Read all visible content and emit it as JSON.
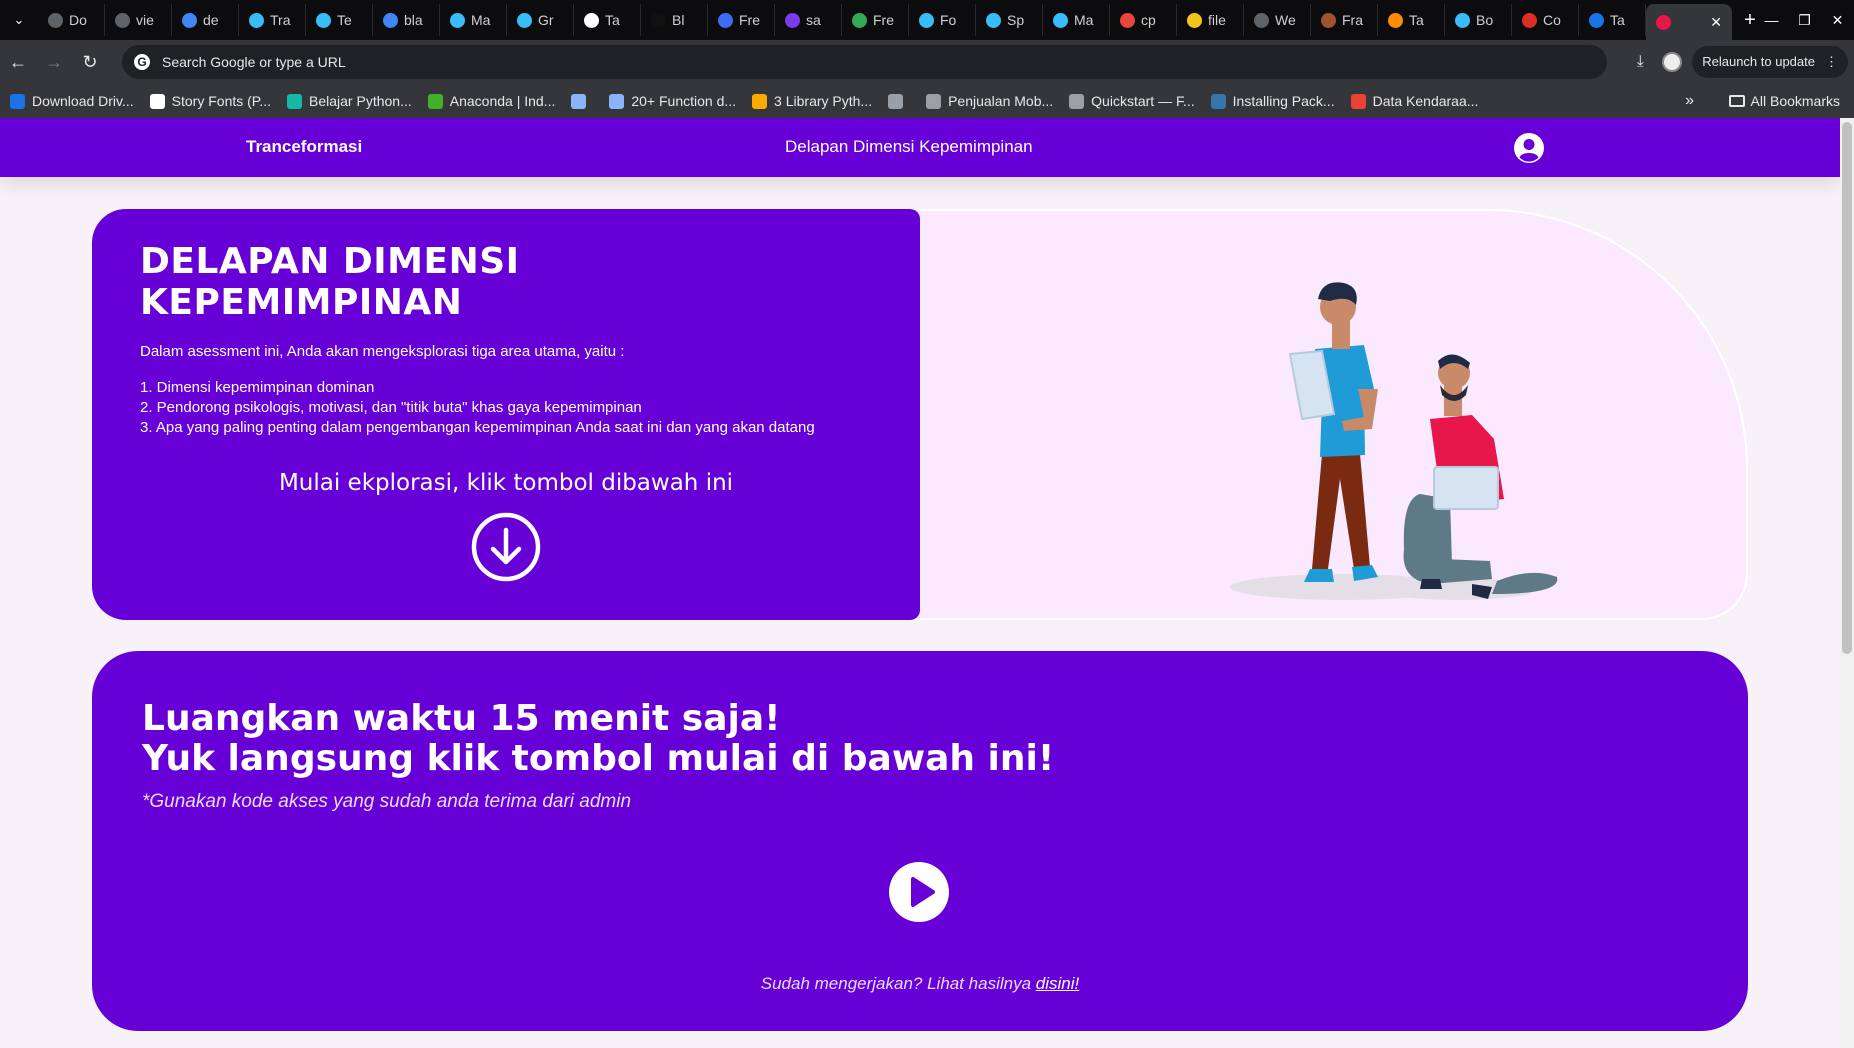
{
  "browser": {
    "tabs": [
      {
        "label": "Do",
        "icon_color": "#5f6368"
      },
      {
        "label": "vie",
        "icon_color": "#5f6368"
      },
      {
        "label": "de",
        "icon_color": "#4285f4"
      },
      {
        "label": "Tra",
        "icon_color": "#38bdf8"
      },
      {
        "label": "Te",
        "icon_color": "#38bdf8"
      },
      {
        "label": "bla",
        "icon_color": "#4285f4"
      },
      {
        "label": "Ma",
        "icon_color": "#38bdf8"
      },
      {
        "label": "Gr",
        "icon_color": "#38bdf8"
      },
      {
        "label": "Ta",
        "icon_color": "#ffffff"
      },
      {
        "label": "Bl",
        "icon_color": "#111111"
      },
      {
        "label": "Fre",
        "icon_color": "#3b6ef5"
      },
      {
        "label": "sa",
        "icon_color": "#7c3aed"
      },
      {
        "label": "Fre",
        "icon_color": "#34a853"
      },
      {
        "label": "Fo",
        "icon_color": "#38bdf8"
      },
      {
        "label": "Sp",
        "icon_color": "#38bdf8"
      },
      {
        "label": "Ma",
        "icon_color": "#38bdf8"
      },
      {
        "label": "cp",
        "icon_color": "#e8453c"
      },
      {
        "label": "file",
        "icon_color": "#f5c518"
      },
      {
        "label": "We",
        "icon_color": "#5f6368"
      },
      {
        "label": "Fra",
        "icon_color": "#a0522d"
      },
      {
        "label": "Ta",
        "icon_color": "#ff8c00"
      },
      {
        "label": "Bo",
        "icon_color": "#38bdf8"
      },
      {
        "label": "Co",
        "icon_color": "#d93025"
      },
      {
        "label": "Ta",
        "icon_color": "#1a73e8"
      }
    ],
    "omnibox_placeholder": "Search Google or type a URL",
    "relaunch_label": "Relaunch to update",
    "bookmarks": [
      {
        "label": "Download Driv...",
        "icon_color": "#1a73e8"
      },
      {
        "label": "Story Fonts (P...",
        "icon_color": "#ffffff"
      },
      {
        "label": "Belajar Python...",
        "icon_color": "#14b8a6"
      },
      {
        "label": "Anaconda | Ind...",
        "icon_color": "#43b02a"
      },
      {
        "label": "",
        "icon_color": "#8ab4f8"
      },
      {
        "label": "20+ Function d...",
        "icon_color": "#8ab4f8"
      },
      {
        "label": "3 Library Pyth...",
        "icon_color": "#f9ab00"
      },
      {
        "label": "",
        "icon_color": "#9aa0a6"
      },
      {
        "label": "Penjualan Mob...",
        "icon_color": "#9aa0a6"
      },
      {
        "label": "Quickstart — F...",
        "icon_color": "#9aa0a6"
      },
      {
        "label": "Installing Pack...",
        "icon_color": "#3776ab"
      },
      {
        "label": "Data Kendaraa...",
        "icon_color": "#ea4335"
      }
    ],
    "all_bookmarks_label": "All Bookmarks"
  },
  "navbar": {
    "brand": "Tranceformasi",
    "title": "Delapan Dimensi Kepemimpinan"
  },
  "hero": {
    "title": "DELAPAN DIMENSI KEPEMIMPINAN",
    "intro": "Dalam asessment ini, Anda akan mengeksplorasi tiga area utama, yaitu :",
    "items": [
      "1. Dimensi kepemimpinan dominan",
      "2. Pendorong psikologis, motivasi, dan \"titik buta\" khas gaya kepemimpinan",
      "3. Apa yang paling penting dalam pengembangan kepemimpinan Anda saat ini dan yang akan datang"
    ],
    "cta": "Mulai ekplorasi, klik tombol dibawah ini"
  },
  "start_card": {
    "heading_line1": "Luangkan waktu 15 menit saja!",
    "heading_line2": "Yuk langsung klik tombol mulai di bawah ini!",
    "note": "*Gunakan kode akses yang sudah anda terima dari admin",
    "footer_text": "Sudah mengerjakan? Lihat hasilnya ",
    "footer_link": "disini!"
  },
  "colors": {
    "brand_purple": "#6600d6",
    "hero_bg": "#fbeaff"
  }
}
